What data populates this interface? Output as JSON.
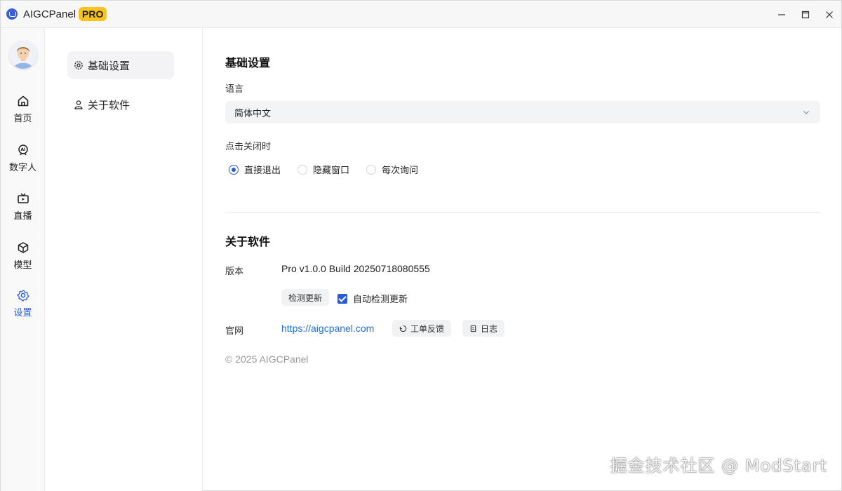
{
  "app": {
    "title": "AIGCPanel",
    "badge": "PRO",
    "badge_color": "#f7c31c"
  },
  "window_controls": [
    "minimize-icon",
    "maximize-icon",
    "close-icon"
  ],
  "sidebar": {
    "items": [
      {
        "label": "首页",
        "icon": "home-icon"
      },
      {
        "label": "数字人",
        "icon": "ai-avatar-icon"
      },
      {
        "label": "直播",
        "icon": "live-tv-icon"
      },
      {
        "label": "模型",
        "icon": "cube-icon"
      },
      {
        "label": "设置",
        "icon": "gear-icon",
        "active": true
      }
    ],
    "active_color": "#2a5bd7"
  },
  "submenu": {
    "items": [
      {
        "label": "基础设置",
        "icon": "gear-icon",
        "active": true
      },
      {
        "label": "关于软件",
        "icon": "user-icon"
      }
    ]
  },
  "basic_settings": {
    "title": "基础设置",
    "language": {
      "label": "语言",
      "value": "简体中文"
    },
    "close_behavior": {
      "label": "点击关闭时",
      "options": [
        "直接退出",
        "隐藏窗口",
        "每次询问"
      ],
      "selected": "直接退出"
    }
  },
  "about": {
    "title": "关于软件",
    "version_label": "版本",
    "version_value": "Pro v1.0.0 Build 20250718080555",
    "check_update_button": "检测更新",
    "auto_check_label": "自动检测更新",
    "auto_check_enabled": true,
    "website_label": "官网",
    "website_link": "https://aigcpanel.com",
    "feedback_button": "工单反馈",
    "log_button": "日志",
    "copyright": "© 2025 AIGCPanel"
  },
  "watermark": "掘金技术社区 @ ModStart"
}
